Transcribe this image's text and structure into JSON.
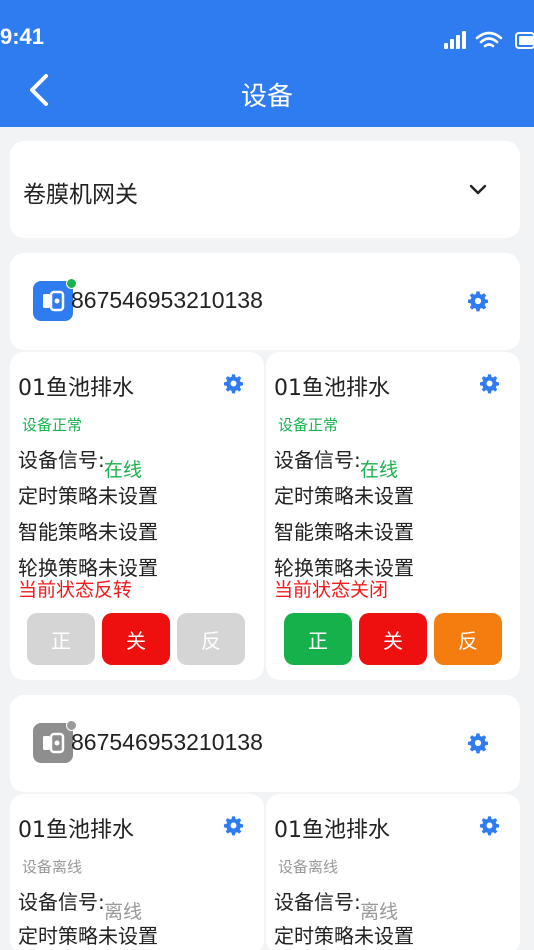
{
  "status_bar": {
    "time": "9:41"
  },
  "header": {
    "title": "设备"
  },
  "dropdown": {
    "label": "卷膜机网关"
  },
  "gateways": [
    {
      "id": "867546953210138",
      "online": true,
      "devices": [
        {
          "name": "01鱼池排水",
          "status": "设备正常",
          "signal_label": "设备信号:",
          "signal_value": "在线",
          "timer_strategy": "定时策略未设置",
          "smart_strategy": "智能策略未设置",
          "rotate_strategy": "轮换策略未设置",
          "current_state": "当前状态反转",
          "buttons": [
            {
              "label": "正",
              "color": "#d5d5d5"
            },
            {
              "label": "关",
              "color": "#ee0f0f"
            },
            {
              "label": "反",
              "color": "#d5d5d5"
            }
          ]
        },
        {
          "name": "01鱼池排水",
          "status": "设备正常",
          "signal_label": "设备信号:",
          "signal_value": "在线",
          "timer_strategy": "定时策略未设置",
          "smart_strategy": "智能策略未设置",
          "rotate_strategy": "轮换策略未设置",
          "current_state": "当前状态关闭",
          "buttons": [
            {
              "label": "正",
              "color": "#16b14b"
            },
            {
              "label": "关",
              "color": "#ee0f0f"
            },
            {
              "label": "反",
              "color": "#f57c0f"
            }
          ]
        }
      ]
    },
    {
      "id": "867546953210138",
      "online": false,
      "devices": [
        {
          "name": "01鱼池排水",
          "status": "设备离线",
          "signal_label": "设备信号:",
          "signal_value": "离线",
          "timer_strategy": "定时策略未设置"
        },
        {
          "name": "01鱼池排水",
          "status": "设备离线",
          "signal_label": "设备信号:",
          "signal_value": "离线",
          "timer_strategy": "定时策略未设置"
        }
      ]
    }
  ],
  "colors": {
    "accent": "#2f7cf0",
    "online_green": "#1ab14e",
    "offline_gray": "#999999",
    "state_red": "#ee1c1c",
    "gateway_online_icon": "#2f7cf0",
    "gateway_offline_icon": "#8e8e8e"
  },
  "icons": {
    "back": "chevron-left-icon",
    "dropdown": "chevron-down-icon",
    "settings": "gear-icon",
    "gateway": "gateway-device-icon",
    "signal": "cellular-signal-icon",
    "wifi": "wifi-icon",
    "battery": "battery-icon"
  }
}
